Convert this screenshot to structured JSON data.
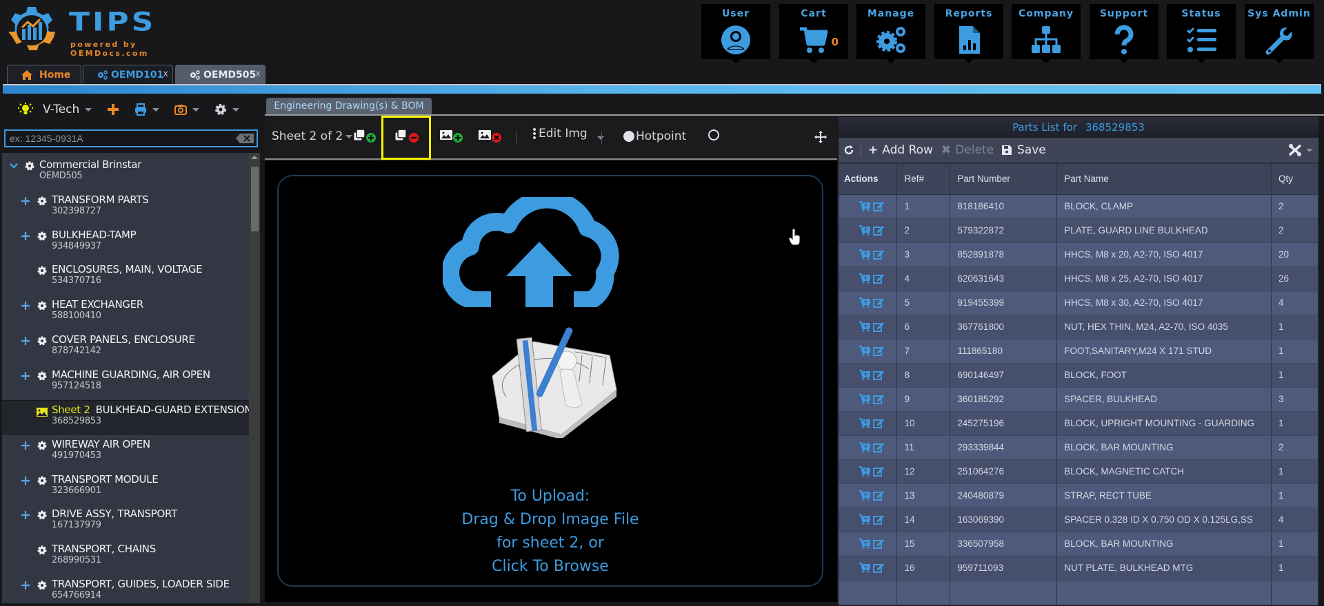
{
  "app": {
    "brand": "TIPS",
    "tagline": "powered by OEMDocs.com"
  },
  "nav": [
    {
      "label": "User",
      "icon": "user-circle-icon"
    },
    {
      "label": "Cart",
      "icon": "cart-icon",
      "badge": "0"
    },
    {
      "label": "Manage",
      "icon": "gears-icon"
    },
    {
      "label": "Reports",
      "icon": "report-file-icon"
    },
    {
      "label": "Company",
      "icon": "org-chart-icon"
    },
    {
      "label": "Support",
      "icon": "question-icon"
    },
    {
      "label": "Status",
      "icon": "checklist-icon"
    },
    {
      "label": "Sys Admin",
      "icon": "wrench-icon"
    }
  ],
  "tabs": [
    {
      "label": "Home",
      "icon": "home-icon",
      "closable": false
    },
    {
      "label": "OEMD101",
      "icon": "gears-icon",
      "closable": true
    },
    {
      "label": "OEMD505",
      "icon": "gears-icon",
      "closable": true,
      "active": true
    }
  ],
  "tab_close": "x",
  "left_toolbar": {
    "company": "V-Tech"
  },
  "search": {
    "placeholder": "ex: 12345-0931A",
    "value": ""
  },
  "tree": {
    "root": {
      "name": "Commercial Brinstar",
      "number": "OEMD505"
    },
    "items": [
      {
        "name": "TRANSFORM PARTS",
        "number": "302398727",
        "expandable": true
      },
      {
        "name": "BULKHEAD-TAMP",
        "number": "934849937",
        "expandable": true
      },
      {
        "name": "ENCLOSURES, MAIN, VOLTAGE",
        "number": "534370716",
        "expandable": false
      },
      {
        "name": "HEAT EXCHANGER",
        "number": "588100410",
        "expandable": true
      },
      {
        "name": "COVER PANELS, ENCLOSURE",
        "number": "878742142",
        "expandable": true
      },
      {
        "name": "MACHINE GUARDING, AIR OPEN",
        "number": "957124518",
        "expandable": true
      },
      {
        "name": "BULKHEAD-GUARD EXTENSION",
        "number": "368529853",
        "expandable": false,
        "sheet": "Sheet 2",
        "selected": true
      },
      {
        "name": "WIREWAY AIR OPEN",
        "number": "491970453",
        "expandable": true
      },
      {
        "name": "TRANSPORT MODULE",
        "number": "323666901",
        "expandable": true
      },
      {
        "name": "DRIVE ASSY, TRANSPORT",
        "number": "167137979",
        "expandable": true
      },
      {
        "name": "TRANSPORT, CHAINS",
        "number": "268990531",
        "expandable": false
      },
      {
        "name": "TRANSPORT, GUIDES, LOADER SIDE",
        "number": "654766914",
        "expandable": true
      }
    ]
  },
  "middle": {
    "tab": "Engineering Drawing(s) & BOM",
    "sheet_selector": "Sheet 2 of 2",
    "edit_img": "Edit Img",
    "hotpoint": "Hotpoint",
    "upload_lines": [
      "To Upload:",
      "Drag & Drop Image File",
      "for sheet 2, or",
      "Click To Browse"
    ]
  },
  "parts": {
    "title": "Parts List for",
    "part_id": "368529853",
    "toolbar": {
      "add_row": "Add Row",
      "delete": "Delete",
      "save": "Save"
    },
    "columns": [
      "Actions",
      "Ref#",
      "Part Number",
      "Part Name",
      "Qty"
    ],
    "rows": [
      {
        "ref": "1",
        "part_number": "818186410",
        "part_name": "BLOCK, CLAMP",
        "qty": "2"
      },
      {
        "ref": "2",
        "part_number": "579322872",
        "part_name": "PLATE, GUARD LINE BULKHEAD",
        "qty": "2"
      },
      {
        "ref": "3",
        "part_number": "852891878",
        "part_name": "HHCS, M8 x 20, A2-70, ISO 4017",
        "qty": "20"
      },
      {
        "ref": "4",
        "part_number": "620631643",
        "part_name": "HHCS, M8 x 25, A2-70, ISO 4017",
        "qty": "26"
      },
      {
        "ref": "5",
        "part_number": "919455399",
        "part_name": "HHCS, M8 x 30, A2-70, ISO 4017",
        "qty": "4"
      },
      {
        "ref": "6",
        "part_number": "367761800",
        "part_name": "NUT, HEX THIN, M24, A2-70, ISO 4035",
        "qty": "1"
      },
      {
        "ref": "7",
        "part_number": "111865180",
        "part_name": "FOOT,SANITARY,M24 X 171 STUD",
        "qty": "1"
      },
      {
        "ref": "8",
        "part_number": "690146497",
        "part_name": "BLOCK, FOOT",
        "qty": "1"
      },
      {
        "ref": "9",
        "part_number": "360185292",
        "part_name": "SPACER, BULKHEAD",
        "qty": "3"
      },
      {
        "ref": "10",
        "part_number": "245275196",
        "part_name": "BLOCK, UPRIGHT MOUNTING - GUARDING",
        "qty": "1"
      },
      {
        "ref": "11",
        "part_number": "293339844",
        "part_name": "BLOCK, BAR MOUNTING",
        "qty": "2"
      },
      {
        "ref": "12",
        "part_number": "251064276",
        "part_name": "BLOCK, MAGNETIC CATCH",
        "qty": "1"
      },
      {
        "ref": "13",
        "part_number": "240480879",
        "part_name": "STRAP, RECT TUBE",
        "qty": "1"
      },
      {
        "ref": "14",
        "part_number": "163069390",
        "part_name": "SPACER 0.328 ID X 0.750 OD X 0.125LG,SS",
        "qty": "4"
      },
      {
        "ref": "15",
        "part_number": "336507958",
        "part_name": "BLOCK, BAR MOUNTING",
        "qty": "1"
      },
      {
        "ref": "16",
        "part_number": "959711093",
        "part_name": "NUT PLATE, BULKHEAD MTG",
        "qty": "1"
      }
    ]
  },
  "colors": {
    "accent_blue": "#3d9be0",
    "accent_orange": "#e8882a",
    "highlight_yellow": "#f5f500",
    "add_green": "#1ea83a",
    "remove_red": "#e0161e"
  }
}
